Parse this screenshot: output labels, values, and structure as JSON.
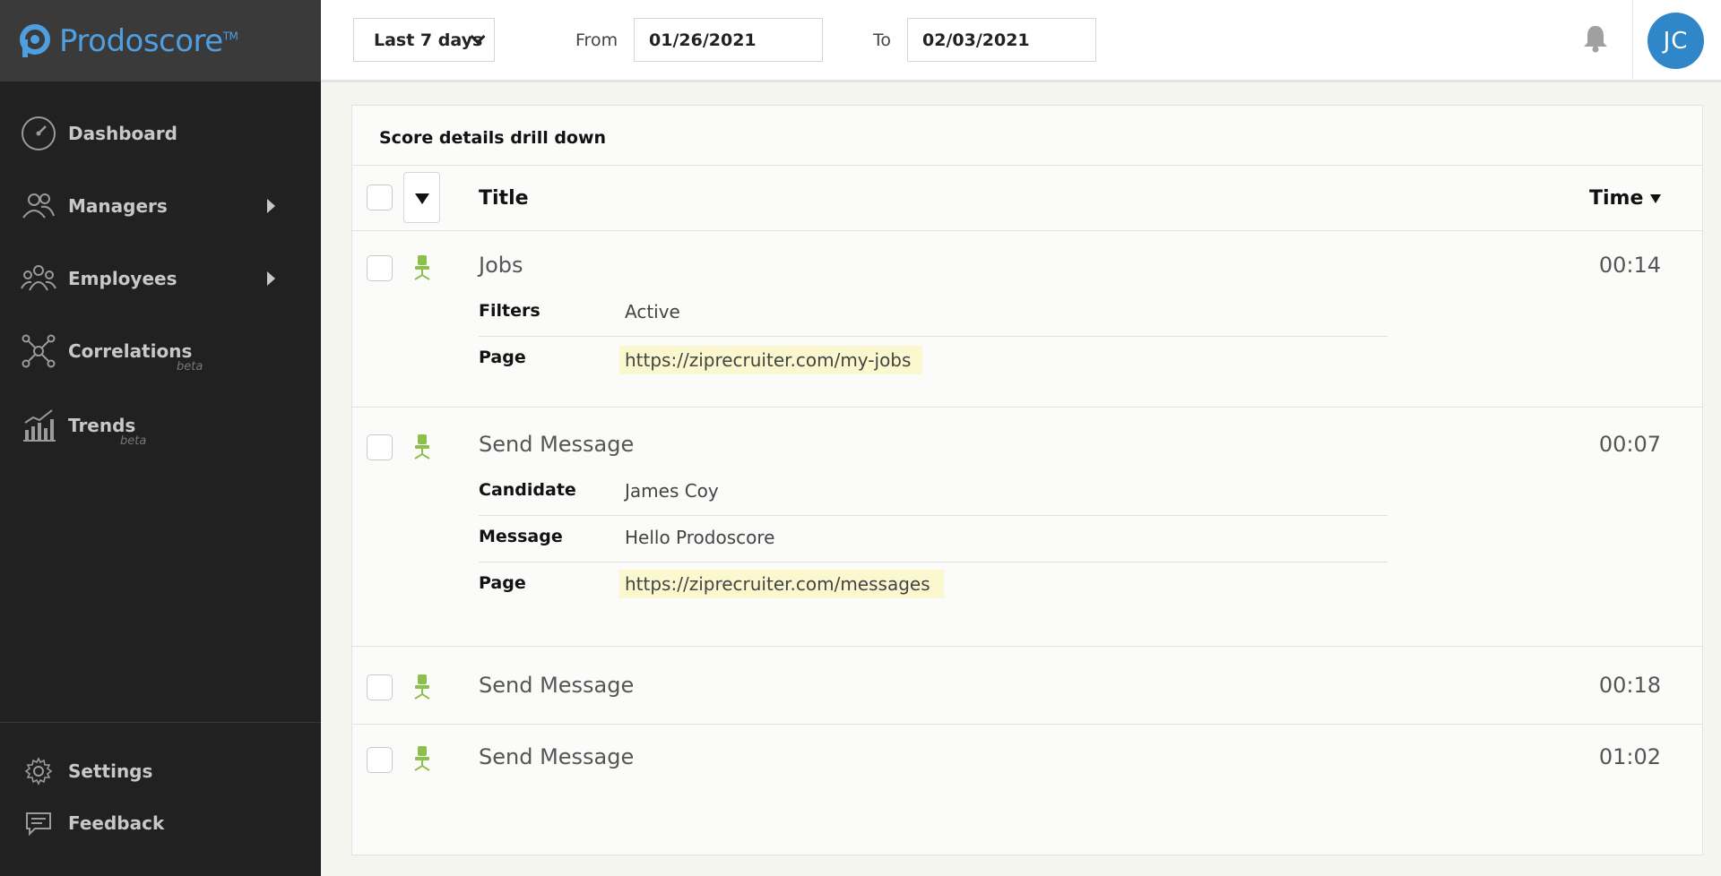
{
  "app": {
    "name": "Prodoscore",
    "tm": "TM",
    "brand_color": "#4f9fe0"
  },
  "sidebar": {
    "items": [
      {
        "label": "Dashboard",
        "icon": "speedometer-icon"
      },
      {
        "label": "Managers",
        "icon": "managers-icon",
        "expandable": true
      },
      {
        "label": "Employees",
        "icon": "employees-icon",
        "expandable": true
      },
      {
        "label": "Correlations",
        "sub": "beta",
        "icon": "correlations-icon"
      },
      {
        "label": "Trends",
        "sub": "beta",
        "icon": "trends-icon"
      }
    ],
    "footer": [
      {
        "label": "Settings",
        "icon": "gear-icon"
      },
      {
        "label": "Feedback",
        "icon": "feedback-icon"
      }
    ]
  },
  "header": {
    "range": "Last 7 days",
    "from_label": "From",
    "from_value": "01/26/2021",
    "to_label": "To",
    "to_value": "02/03/2021",
    "avatar_initials": "JC",
    "avatar_color": "#2f86c9"
  },
  "card": {
    "title": "Score details drill down",
    "columns": {
      "title": "Title",
      "time": "Time"
    },
    "rows": [
      {
        "title": "Jobs",
        "time": "00:14",
        "details": [
          {
            "label": "Filters",
            "value": "Active"
          },
          {
            "label": "Page",
            "value": "https://ziprecruiter.com/my-jobs",
            "highlight": true
          }
        ]
      },
      {
        "title": "Send Message",
        "time": "00:07",
        "details": [
          {
            "label": "Candidate",
            "value": "James Coy"
          },
          {
            "label": "Message",
            "value": "Hello Prodoscore"
          },
          {
            "label": "Page",
            "value": "https://ziprecruiter.com/messages",
            "highlight": true
          }
        ]
      },
      {
        "title": "Send Message",
        "time": "00:18",
        "details": []
      },
      {
        "title": "Send Message",
        "time": "01:02",
        "details": []
      }
    ],
    "chair_color": "#8dc04a",
    "highlight_color": "#fbf7cf"
  }
}
